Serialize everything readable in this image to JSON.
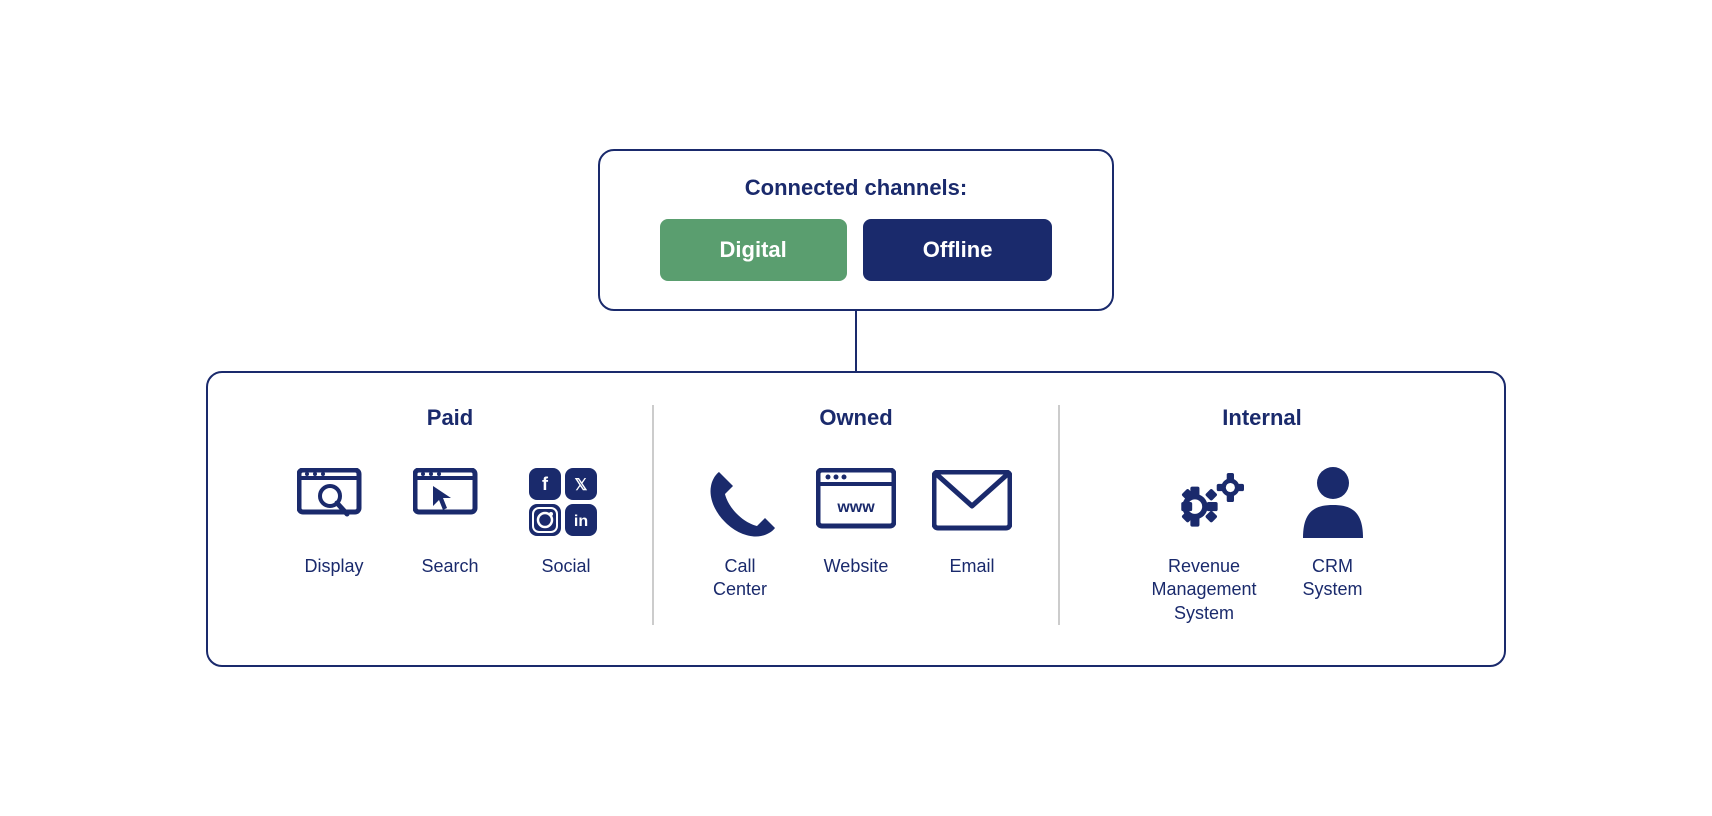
{
  "top": {
    "title": "Connected channels:",
    "buttons": {
      "digital": "Digital",
      "offline": "Offline"
    }
  },
  "sections": {
    "paid": {
      "title": "Paid",
      "items": [
        {
          "label": "Display",
          "icon": "display-icon"
        },
        {
          "label": "Search",
          "icon": "search-icon"
        },
        {
          "label": "Social",
          "icon": "social-icon"
        }
      ]
    },
    "owned": {
      "title": "Owned",
      "items": [
        {
          "label": "Call\nCenter",
          "icon": "call-center-icon"
        },
        {
          "label": "Website",
          "icon": "website-icon"
        },
        {
          "label": "Email",
          "icon": "email-icon"
        }
      ]
    },
    "internal": {
      "title": "Internal",
      "items": [
        {
          "label": "Revenue\nManagement\nSystem",
          "icon": "revenue-management-icon"
        },
        {
          "label": "CRM\nSystem",
          "icon": "crm-system-icon"
        }
      ]
    }
  }
}
